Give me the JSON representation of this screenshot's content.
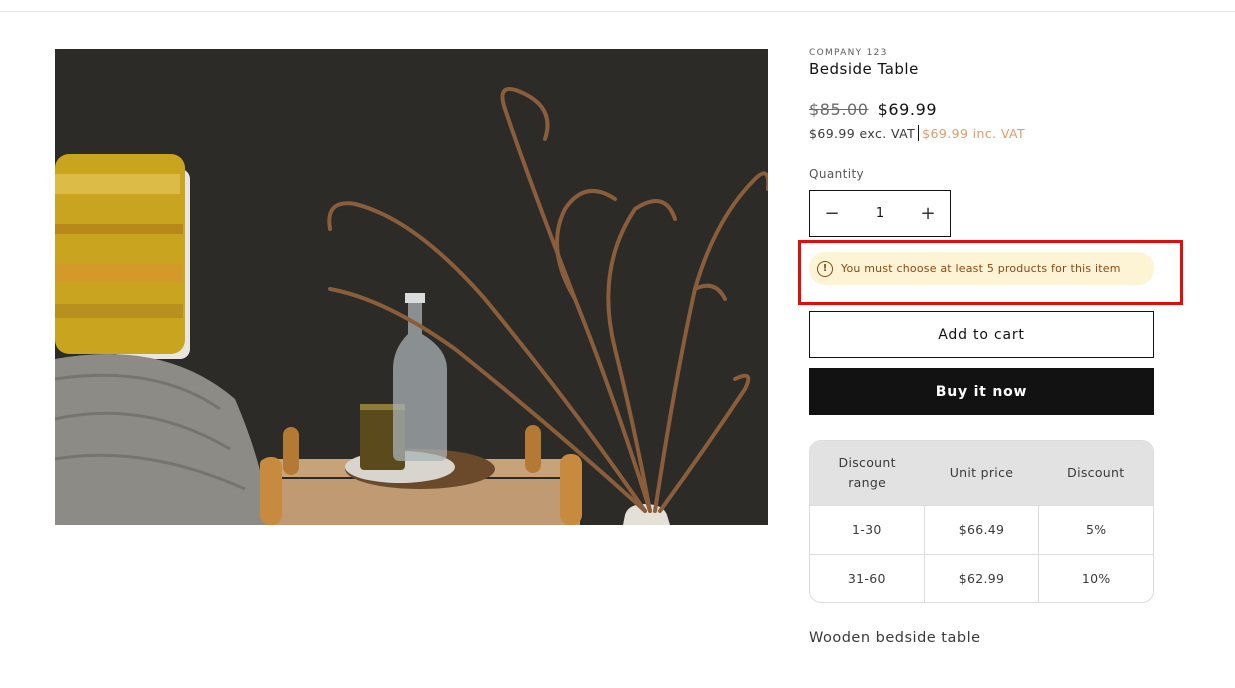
{
  "product": {
    "vendor": "COMPANY 123",
    "title": "Bedside Table",
    "compare_price": "$85.00",
    "sale_price": "$69.99",
    "price_ex_vat": "$69.99 exc. VAT",
    "price_inc_vat": "$69.99 inc. VAT",
    "description": "Wooden bedside table"
  },
  "quantity": {
    "label": "Quantity",
    "value": "1",
    "decrease_symbol": "−",
    "increase_symbol": "+"
  },
  "warning": {
    "icon": "info-circle-icon",
    "icon_glyph": "!",
    "text": "You must choose at least 5 products for this item"
  },
  "buttons": {
    "add_to_cart": "Add to cart",
    "buy_now": "Buy it now"
  },
  "discount_table": {
    "headers": [
      "Discount range",
      "Unit price",
      "Discount"
    ],
    "rows": [
      [
        "1-30",
        "$66.49",
        "5%"
      ],
      [
        "31-60",
        "$62.99",
        "10%"
      ]
    ]
  },
  "colors": {
    "accent_vat": "#e39a69",
    "warning_bg": "#fdf4d6",
    "warning_text": "#8a4a12",
    "highlight": "#e00d0d",
    "button_dark": "#121212"
  }
}
